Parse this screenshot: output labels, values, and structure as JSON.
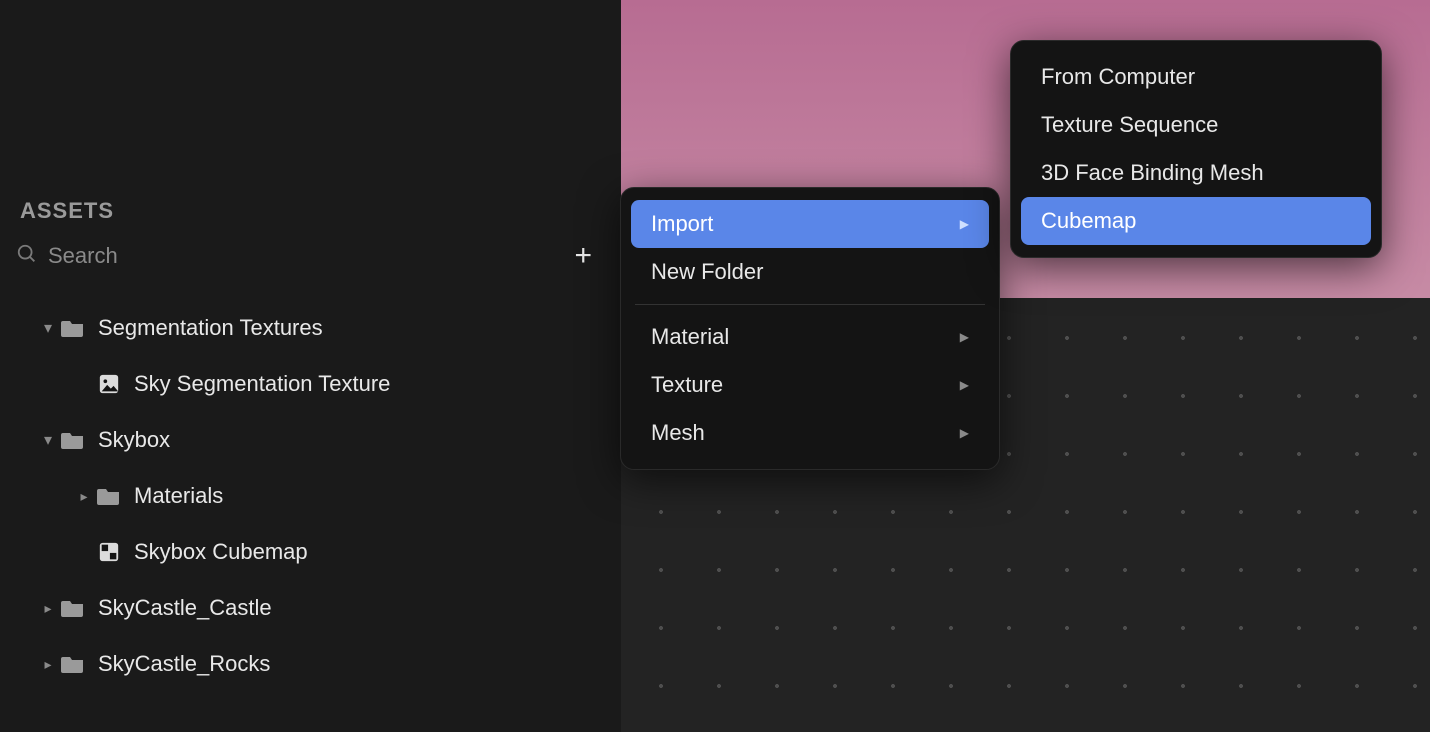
{
  "sidebar": {
    "header": "ASSETS",
    "search_placeholder": "Search",
    "tree": [
      {
        "label": "Segmentation Textures"
      },
      {
        "label": "Sky Segmentation Texture"
      },
      {
        "label": "Skybox"
      },
      {
        "label": "Materials"
      },
      {
        "label": "Skybox Cubemap"
      },
      {
        "label": "SkyCastle_Castle"
      },
      {
        "label": "SkyCastle_Rocks"
      }
    ]
  },
  "menu1": {
    "items": [
      {
        "label": "Import",
        "submenu": true,
        "highlight": true
      },
      {
        "label": "New Folder",
        "submenu": false
      },
      {
        "label": "Material",
        "submenu": true
      },
      {
        "label": "Texture",
        "submenu": true
      },
      {
        "label": "Mesh",
        "submenu": true
      }
    ]
  },
  "menu2": {
    "items": [
      {
        "label": "From Computer"
      },
      {
        "label": "Texture Sequence"
      },
      {
        "label": "3D Face Binding Mesh"
      },
      {
        "label": "Cubemap",
        "highlight": true
      }
    ]
  }
}
